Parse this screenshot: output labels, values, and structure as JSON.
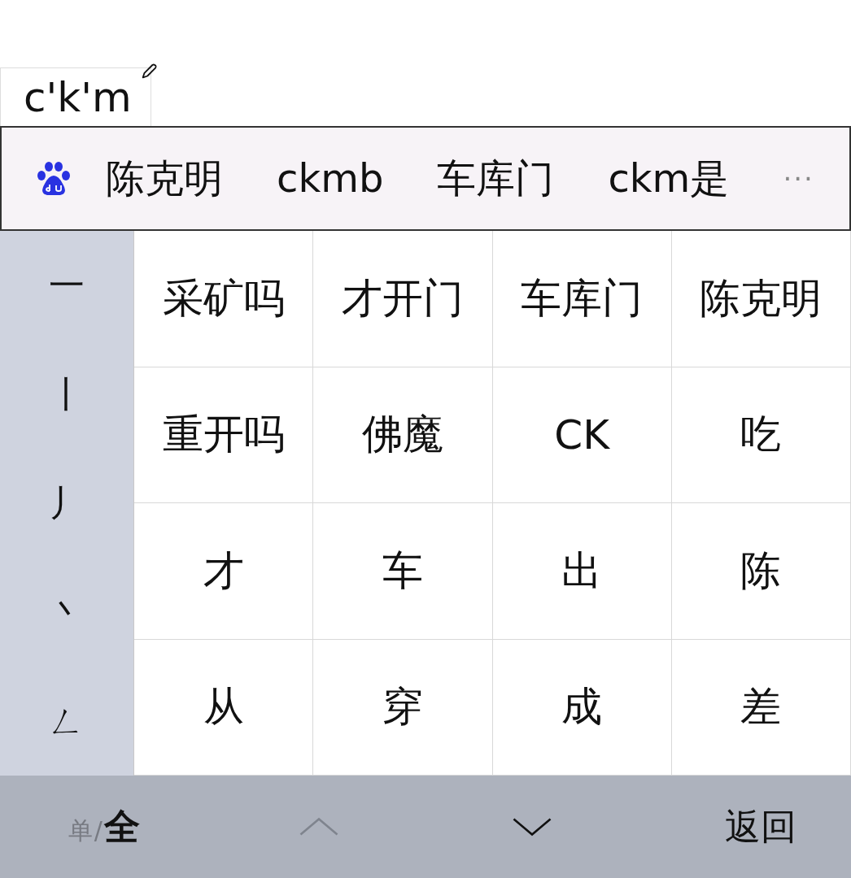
{
  "composition": {
    "text": "c'k'm"
  },
  "candidate_bar": {
    "candidates": [
      "陈克明",
      "ckmb",
      "车库门",
      "ckm是"
    ],
    "more": "···"
  },
  "strokes": [
    "一",
    "丨",
    "丿",
    "丶",
    "ㄥ"
  ],
  "grid": [
    "采矿吗",
    "才开门",
    "车库门",
    "陈克明",
    "重开吗",
    "佛魔",
    "CK",
    "吃",
    "才",
    "车",
    "出",
    "陈",
    "从",
    "穿",
    "成",
    "差"
  ],
  "bottom_bar": {
    "mode": {
      "options": [
        {
          "label": "单",
          "selected": false
        },
        {
          "label": "全",
          "selected": true
        }
      ],
      "separator": "/"
    },
    "page_up": {
      "disabled": true
    },
    "page_down": {
      "disabled": false
    },
    "back": "返回"
  }
}
